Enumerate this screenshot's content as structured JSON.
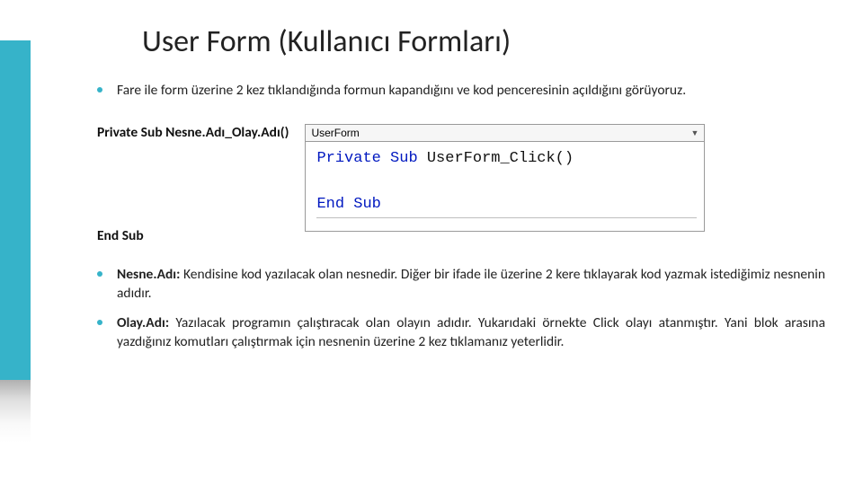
{
  "title": "User Form (Kullanıcı Formları)",
  "bullet_intro": "Fare ile form üzerine 2 kez tıklandığında formun kapandığını ve kod penceresinin açıldığını görüyoruz.",
  "code_declare": "Private Sub Nesne.Adı_Olay.Adı()",
  "code_end": "End Sub",
  "code_window": {
    "dropdown_label": "UserForm",
    "line1_kw1": "Private Sub",
    "line1_rest": " UserForm_Click()",
    "line2_kw": "End Sub"
  },
  "bullet_nesne_label": "Nesne.Adı:",
  "bullet_nesne_text": " Kendisine kod yazılacak olan nesnedir. Diğer bir ifade ile üzerine 2 kere tıklayarak kod yazmak istediğimiz nesnenin adıdır.",
  "bullet_olay_label": "Olay.Adı:",
  "bullet_olay_text": " Yazılacak programın çalıştıracak olan olayın adıdır. Yukarıdaki örnekte Click olayı atanmıştır. Yani blok arasına yazdığınız komutları çalıştırmak için nesnenin üzerine 2 kez tıklamanız yeterlidir."
}
